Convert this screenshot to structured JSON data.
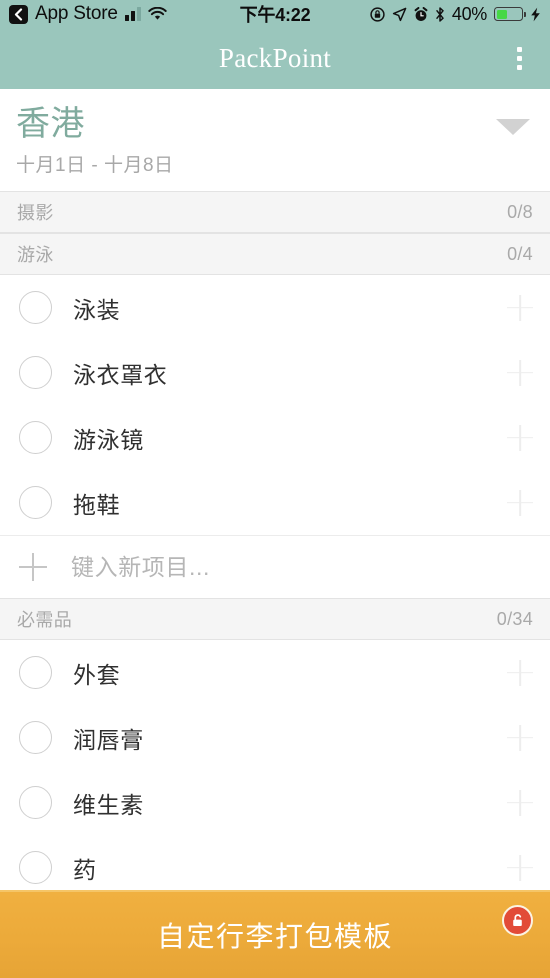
{
  "status_bar": {
    "back_label": "App Store",
    "back_icon": "chevron-left-icon",
    "signal_icon": "cellular-signal-icon",
    "wifi_icon": "wifi-icon",
    "time": "下午4:22",
    "rotation_lock_icon": "rotation-lock-icon",
    "location_icon": "location-arrow-icon",
    "alarm_icon": "alarm-clock-icon",
    "bluetooth_icon": "bluetooth-icon",
    "battery_percent": "40%",
    "battery_level": 40,
    "battery_icon": "battery-icon",
    "charging_icon": "lightning-bolt-icon"
  },
  "toolbar": {
    "title": "PackPoint",
    "overflow_icon": "overflow-menu-icon"
  },
  "trip": {
    "destination": "香港",
    "dates": "十月1日 - 十月8日",
    "caret_icon": "chevron-down-icon"
  },
  "sections": [
    {
      "name": "摄影",
      "count": "0/8",
      "items": []
    },
    {
      "name": "游泳",
      "count": "0/4",
      "items": [
        {
          "label": "泳装",
          "checked": false
        },
        {
          "label": "泳衣罩衣",
          "checked": false
        },
        {
          "label": "游泳镜",
          "checked": false
        },
        {
          "label": "拖鞋",
          "checked": false
        }
      ]
    }
  ],
  "add_item": {
    "value": "",
    "placeholder": "键入新项目...",
    "plus_icon": "plus-icon"
  },
  "essentials": {
    "name": "必需品",
    "count": "0/34",
    "items": [
      {
        "label": "外套",
        "checked": false
      },
      {
        "label": "润唇膏",
        "checked": false
      },
      {
        "label": "维生素",
        "checked": false
      },
      {
        "label": "药",
        "checked": false
      }
    ]
  },
  "banner": {
    "text": "自定行李打包模板",
    "lock_icon": "unlock-padlock-icon"
  },
  "colors": {
    "toolbar": "#9ac6bc",
    "destination_text": "#80ab9e",
    "banner": "#eeae3d",
    "lock_badge": "#e24b38",
    "battery_fill": "#46d845"
  }
}
